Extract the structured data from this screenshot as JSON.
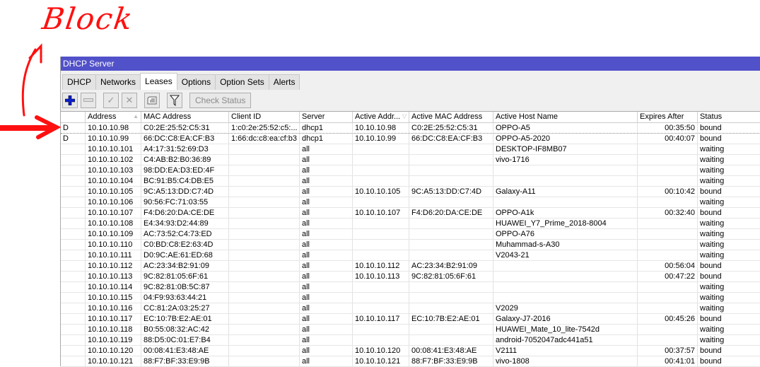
{
  "annotation": {
    "text": "Block",
    "color": "#ff1010"
  },
  "window": {
    "title": "DHCP Server"
  },
  "tabs": [
    {
      "label": "DHCP"
    },
    {
      "label": "Networks"
    },
    {
      "label": "Leases",
      "active": true
    },
    {
      "label": "Options"
    },
    {
      "label": "Option Sets"
    },
    {
      "label": "Alerts"
    }
  ],
  "toolbar": {
    "check_status": "Check Status"
  },
  "columns": [
    "",
    "Address",
    "MAC Address",
    "Client ID",
    "Server",
    "Active Addr...",
    "Active MAC Address",
    "Active Host Name",
    "Expires After",
    "Status"
  ],
  "rows": [
    [
      "D",
      "10.10.10.98",
      "C0:2E:25:52:C5:31",
      "1:c0:2e:25:52:c5:...",
      "dhcp1",
      "10.10.10.98",
      "C0:2E:25:52:C5:31",
      "OPPO-A5",
      "00:35:50",
      "bound"
    ],
    [
      "D",
      "10.10.10.99",
      "66:DC:C8:EA:CF:B3",
      "1:66:dc:c8:ea:cf:b3",
      "dhcp1",
      "10.10.10.99",
      "66:DC:C8:EA:CF:B3",
      "OPPO-A5-2020",
      "00:40:07",
      "bound"
    ],
    [
      "",
      "10.10.10.101",
      "A4:17:31:52:69:D3",
      "",
      "all",
      "",
      "",
      "DESKTOP-IF8MB07",
      "",
      "waiting"
    ],
    [
      "",
      "10.10.10.102",
      "C4:AB:B2:B0:36:89",
      "",
      "all",
      "",
      "",
      "vivo-1716",
      "",
      "waiting"
    ],
    [
      "",
      "10.10.10.103",
      "98:DD:EA:D3:ED:4F",
      "",
      "all",
      "",
      "",
      "",
      "",
      "waiting"
    ],
    [
      "",
      "10.10.10.104",
      "BC:91:B5:C4:DB:E5",
      "",
      "all",
      "",
      "",
      "",
      "",
      "waiting"
    ],
    [
      "",
      "10.10.10.105",
      "9C:A5:13:DD:C7:4D",
      "",
      "all",
      "10.10.10.105",
      "9C:A5:13:DD:C7:4D",
      "Galaxy-A11",
      "00:10:42",
      "bound"
    ],
    [
      "",
      "10.10.10.106",
      "90:56:FC:71:03:55",
      "",
      "all",
      "",
      "",
      "",
      "",
      "waiting"
    ],
    [
      "",
      "10.10.10.107",
      "F4:D6:20:DA:CE:DE",
      "",
      "all",
      "10.10.10.107",
      "F4:D6:20:DA:CE:DE",
      "OPPO-A1k",
      "00:32:40",
      "bound"
    ],
    [
      "",
      "10.10.10.108",
      "E4:34:93:D2:44:89",
      "",
      "all",
      "",
      "",
      "HUAWEI_Y7_Prime_2018-8004",
      "",
      "waiting"
    ],
    [
      "",
      "10.10.10.109",
      "AC:73:52:C4:73:ED",
      "",
      "all",
      "",
      "",
      "OPPO-A76",
      "",
      "waiting"
    ],
    [
      "",
      "10.10.10.110",
      "C0:BD:C8:E2:63:4D",
      "",
      "all",
      "",
      "",
      "Muhammad-s-A30",
      "",
      "waiting"
    ],
    [
      "",
      "10.10.10.111",
      "D0:9C:AE:61:ED:68",
      "",
      "all",
      "",
      "",
      "V2043-21",
      "",
      "waiting"
    ],
    [
      "",
      "10.10.10.112",
      "AC:23:34:B2:91:09",
      "",
      "all",
      "10.10.10.112",
      "AC:23:34:B2:91:09",
      "",
      "00:56:04",
      "bound"
    ],
    [
      "",
      "10.10.10.113",
      "9C:82:81:05:6F:61",
      "",
      "all",
      "10.10.10.113",
      "9C:82:81:05:6F:61",
      "",
      "00:47:22",
      "bound"
    ],
    [
      "",
      "10.10.10.114",
      "9C:82:81:0B:5C:87",
      "",
      "all",
      "",
      "",
      "",
      "",
      "waiting"
    ],
    [
      "",
      "10.10.10.115",
      "04:F9:93:63:44:21",
      "",
      "all",
      "",
      "",
      "",
      "",
      "waiting"
    ],
    [
      "",
      "10.10.10.116",
      "CC:81:2A:03:25:27",
      "",
      "all",
      "",
      "",
      "V2029",
      "",
      "waiting"
    ],
    [
      "",
      "10.10.10.117",
      "EC:10:7B:E2:AE:01",
      "",
      "all",
      "10.10.10.117",
      "EC:10:7B:E2:AE:01",
      "Galaxy-J7-2016",
      "00:45:26",
      "bound"
    ],
    [
      "",
      "10.10.10.118",
      "B0:55:08:32:AC:42",
      "",
      "all",
      "",
      "",
      "HUAWEI_Mate_10_lite-7542d",
      "",
      "waiting"
    ],
    [
      "",
      "10.10.10.119",
      "88:D5:0C:01:E7:B4",
      "",
      "all",
      "",
      "",
      "android-7052047adc441a51",
      "",
      "waiting"
    ],
    [
      "",
      "10.10.10.120",
      "00:08:41:E3:48:AE",
      "",
      "all",
      "10.10.10.120",
      "00:08:41:E3:48:AE",
      "V2111",
      "00:37:57",
      "bound"
    ],
    [
      "",
      "10.10.10.121",
      "88:F7:BF:33:E9:9B",
      "",
      "all",
      "10.10.10.121",
      "88:F7:BF:33:E9:9B",
      "vivo-1808",
      "00:41:01",
      "bound"
    ]
  ]
}
